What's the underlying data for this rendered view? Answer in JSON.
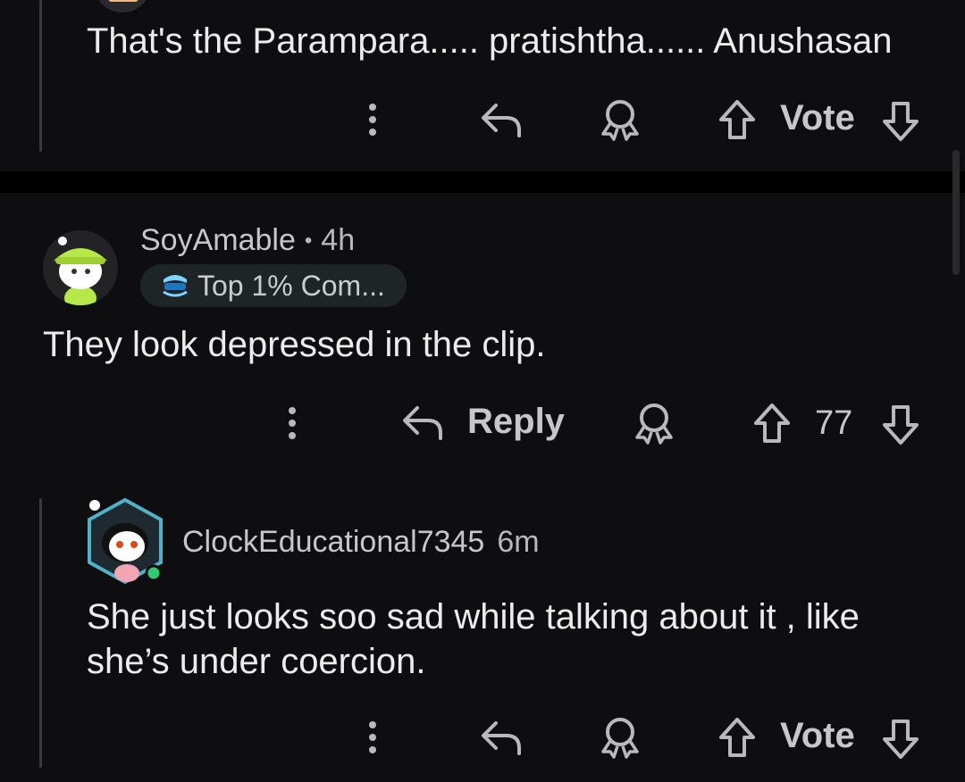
{
  "comment_top": {
    "text": "That's the Parampara..... pratishtha...... Anushasan",
    "actions": {
      "vote_label": "Vote"
    }
  },
  "comment_main": {
    "username": "SoyAmable",
    "separator": "•",
    "time": "4h",
    "badge_label": "Top 1% Com...",
    "text": "They look depressed in the clip.",
    "actions": {
      "reply_label": "Reply",
      "vote_count": "77"
    }
  },
  "comment_reply": {
    "username": "ClockEducational7345",
    "time": "6m",
    "text_line1": "She just looks soo sad while talking about it , like",
    "text_line2": "she’s under coercion.",
    "actions": {
      "vote_label": "Vote"
    }
  },
  "colors": {
    "background": "#0e0e10",
    "divider": "#000000",
    "icon": "#b9b9bd",
    "online_dot": "#2ecc71"
  }
}
